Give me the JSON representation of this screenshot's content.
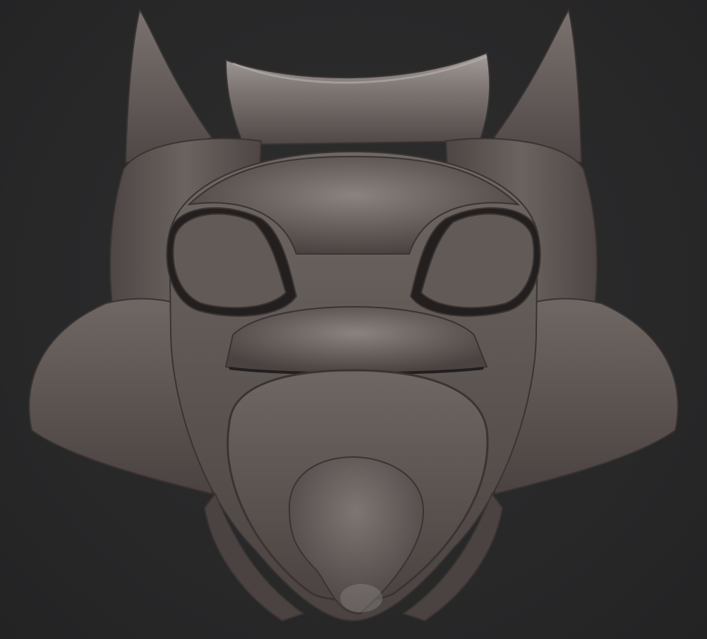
{
  "scene": {
    "subject": "sculpted-mask-render",
    "colors": {
      "background": "#2a2a2b",
      "clay_base": "#5e5754",
      "clay_light": "#8c8582",
      "clay_dark": "#3a3432",
      "cavity": "#1e1b1a"
    }
  }
}
